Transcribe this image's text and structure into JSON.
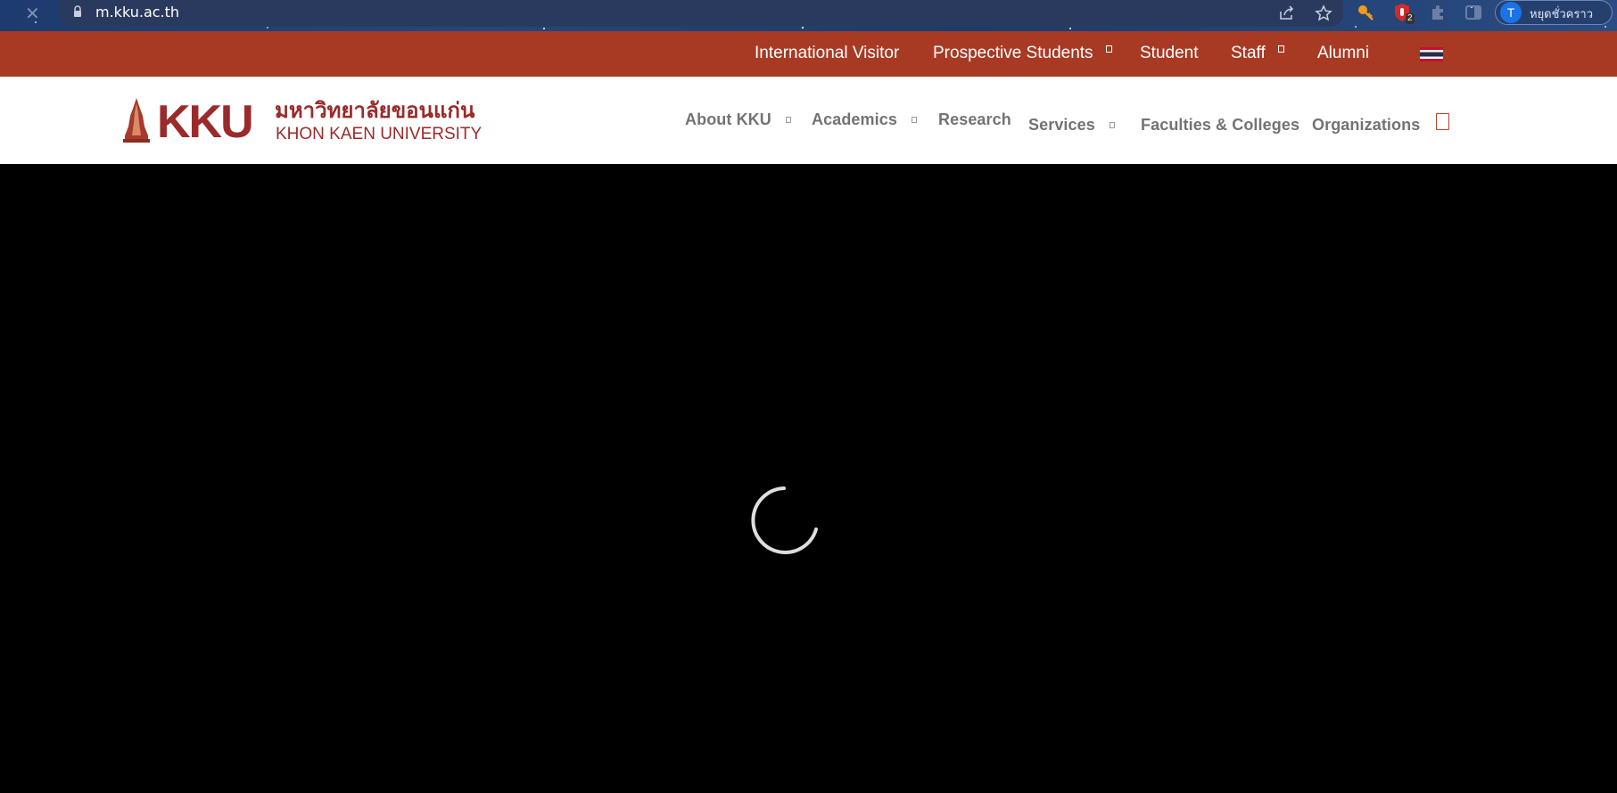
{
  "browser": {
    "url": "m.kku.ac.th",
    "profile_initial": "T",
    "profile_label": "หยุดชั่วคราว",
    "extension_badge": "2"
  },
  "top_nav": {
    "items": [
      {
        "label": "International Visitor",
        "has_dropdown": false
      },
      {
        "label": "Prospective Students",
        "has_dropdown": true
      },
      {
        "label": "Student",
        "has_dropdown": false
      },
      {
        "label": "Staff",
        "has_dropdown": true
      },
      {
        "label": "Alumni",
        "has_dropdown": false
      }
    ],
    "language_flag": "thai-flag-icon",
    "background_color": "#a83a24"
  },
  "header": {
    "logo": {
      "short": "KKU",
      "thai_name": "มหาวิทยาลัยขอนแก่น",
      "english_name": "KHON KAEN UNIVERSITY",
      "color": "#9b2a2a"
    },
    "nav": [
      {
        "label": "About KKU",
        "has_dropdown": true
      },
      {
        "label": "Academics",
        "has_dropdown": true
      },
      {
        "label": "Research",
        "has_dropdown": false
      },
      {
        "label": "Services",
        "has_dropdown": true
      },
      {
        "label": "Faculties & Colleges",
        "has_dropdown": false
      },
      {
        "label": "Organizations",
        "has_dropdown": false
      }
    ],
    "search_icon": "search-box-icon"
  },
  "hero": {
    "state": "loading",
    "spinner_icon": "loading-spinner-icon"
  }
}
